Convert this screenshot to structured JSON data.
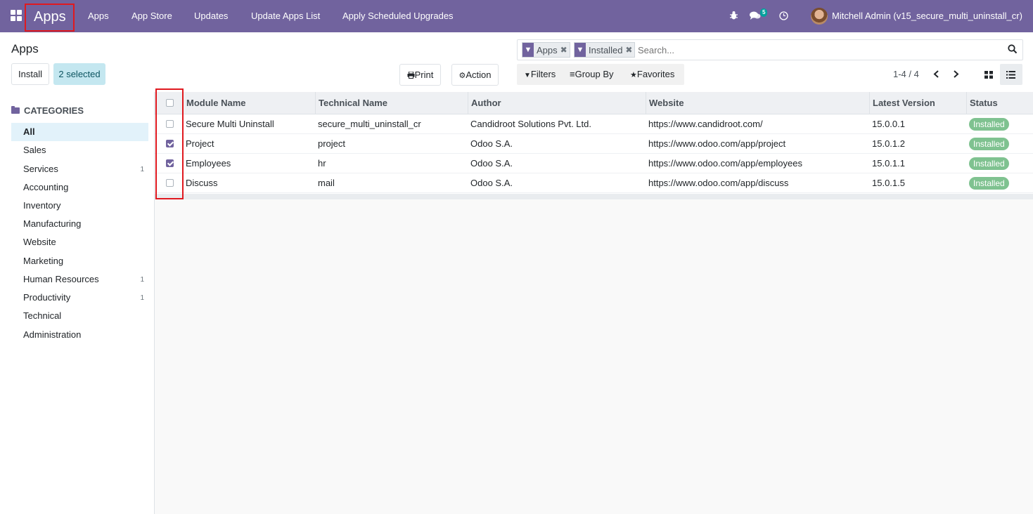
{
  "navbar": {
    "brand": "Apps",
    "menu": [
      "Apps",
      "App Store",
      "Updates",
      "Update Apps List",
      "Apply Scheduled Upgrades"
    ],
    "messages_count": "5",
    "user": "Mitchell Admin (v15_secure_multi_uninstall_cr)"
  },
  "control": {
    "title": "Apps",
    "install_label": "Install",
    "selected_label": "2 selected",
    "print_label": "Print",
    "action_label": "Action",
    "facets": [
      "Apps",
      "Installed"
    ],
    "search_placeholder": "Search...",
    "filters_label": "Filters",
    "groupby_label": "Group By",
    "favorites_label": "Favorites",
    "pager": "1-4 / 4"
  },
  "sidebar": {
    "heading": "CATEGORIES",
    "items": [
      {
        "label": "All",
        "count": ""
      },
      {
        "label": "Sales",
        "count": ""
      },
      {
        "label": "Services",
        "count": "1"
      },
      {
        "label": "Accounting",
        "count": ""
      },
      {
        "label": "Inventory",
        "count": ""
      },
      {
        "label": "Manufacturing",
        "count": ""
      },
      {
        "label": "Website",
        "count": ""
      },
      {
        "label": "Marketing",
        "count": ""
      },
      {
        "label": "Human Resources",
        "count": "1"
      },
      {
        "label": "Productivity",
        "count": "1"
      },
      {
        "label": "Technical",
        "count": ""
      },
      {
        "label": "Administration",
        "count": ""
      }
    ]
  },
  "table": {
    "headers": [
      "Module Name",
      "Technical Name",
      "Author",
      "Website",
      "Latest Version",
      "Status"
    ],
    "rows": [
      {
        "name": "Secure Multi Uninstall",
        "tech": "secure_multi_uninstall_cr",
        "author": "Candidroot Solutions Pvt. Ltd.",
        "website": "https://www.candidroot.com/",
        "version": "15.0.0.1",
        "status": "Installed",
        "checked": false
      },
      {
        "name": "Project",
        "tech": "project",
        "author": "Odoo S.A.",
        "website": "https://www.odoo.com/app/project",
        "version": "15.0.1.2",
        "status": "Installed",
        "checked": true
      },
      {
        "name": "Employees",
        "tech": "hr",
        "author": "Odoo S.A.",
        "website": "https://www.odoo.com/app/employees",
        "version": "15.0.1.1",
        "status": "Installed",
        "checked": true
      },
      {
        "name": "Discuss",
        "tech": "mail",
        "author": "Odoo S.A.",
        "website": "https://www.odoo.com/app/discuss",
        "version": "15.0.1.5",
        "status": "Installed",
        "checked": false
      }
    ]
  }
}
